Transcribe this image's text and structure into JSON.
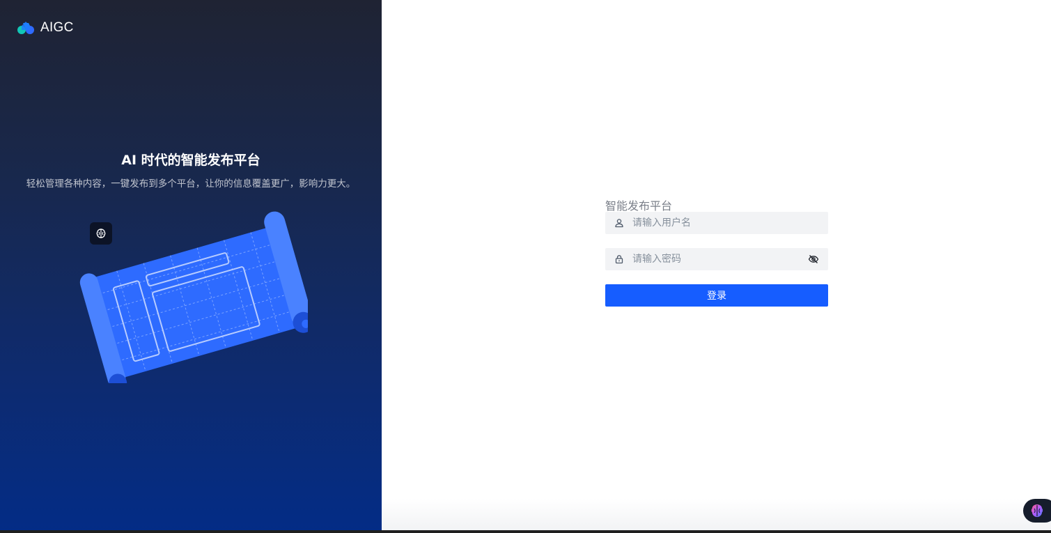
{
  "brand": {
    "name": "AIGC"
  },
  "hero": {
    "title": "AI 时代的智能发布平台",
    "subtitle": "轻松管理各种内容，一键发布到多个平台，让你的信息覆盖更广，影响力更大。"
  },
  "login_form": {
    "title": "智能发布平台",
    "username_placeholder": "请输入用户名",
    "username_value": "",
    "password_placeholder": "请输入密码",
    "password_value": "",
    "submit_label": "登录"
  },
  "icons": {
    "logo": "aigc-logo-icon",
    "user": "user-icon",
    "lock": "lock-icon",
    "password_toggle": "eye-off-icon",
    "badge": "brain-icon",
    "floating": "brain-icon"
  },
  "colors": {
    "primary": "#165dff",
    "left_panel_top": "#1f2333",
    "left_panel_bottom": "#032c86",
    "input_bg": "#f2f3f5"
  }
}
